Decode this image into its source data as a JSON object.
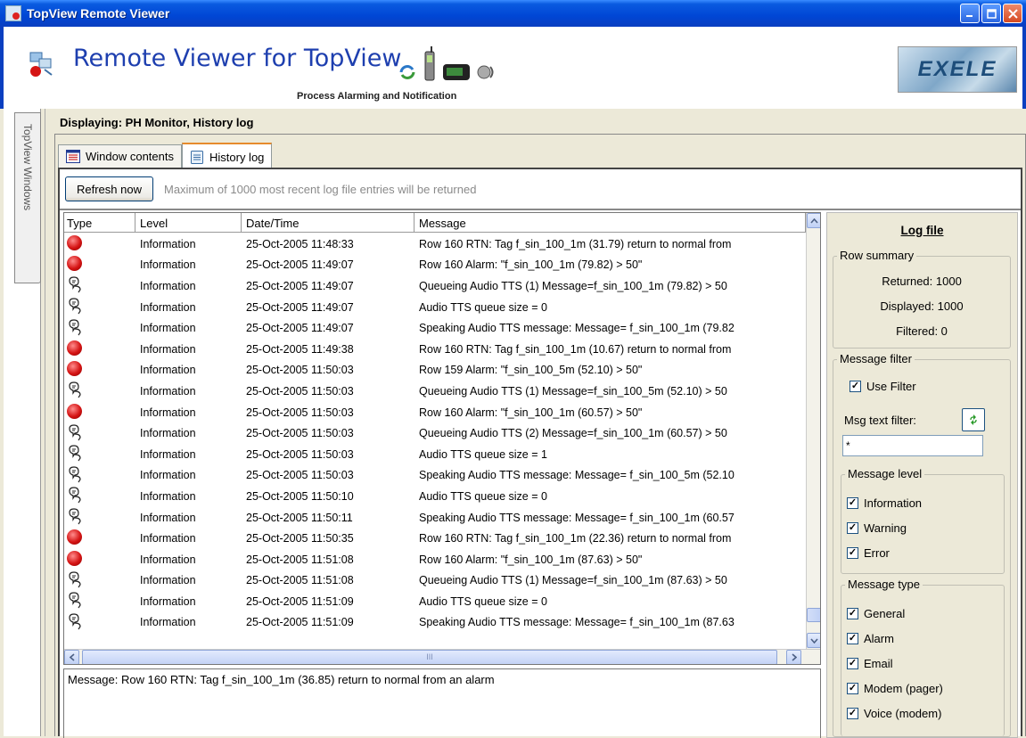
{
  "window": {
    "title": "TopView Remote Viewer"
  },
  "banner": {
    "headline": "Remote Viewer for TopView",
    "subtitle": "Process Alarming and Notification",
    "brand": "EXELE"
  },
  "rail": {
    "tab_label": "TopView Windows"
  },
  "main": {
    "displaying": "Displaying: PH Monitor, History log",
    "tabs": [
      {
        "label": "Window contents",
        "icon": "list-window-icon",
        "active": false
      },
      {
        "label": "History log",
        "icon": "document-icon",
        "active": true
      }
    ],
    "toolbar": {
      "refresh_label": "Refresh now",
      "hint": "Maximum of 1000 most recent log file entries will be returned"
    }
  },
  "table": {
    "columns": [
      "Type",
      "Level",
      "Date/Time",
      "Message"
    ],
    "rows": [
      {
        "type": "alarm",
        "level": "Information",
        "datetime": "25-Oct-2005 11:48:33",
        "message": "Row 160 RTN: Tag f_sin_100_1m (31.79) return to normal from"
      },
      {
        "type": "alarm",
        "level": "Information",
        "datetime": "25-Oct-2005 11:49:07",
        "message": "Row 160 Alarm: \"f_sin_100_1m (79.82) > 50\""
      },
      {
        "type": "voice",
        "level": "Information",
        "datetime": "25-Oct-2005 11:49:07",
        "message": "Queueing Audio TTS (1) Message=f_sin_100_1m (79.82) > 50"
      },
      {
        "type": "voice",
        "level": "Information",
        "datetime": "25-Oct-2005 11:49:07",
        "message": "Audio TTS queue size = 0"
      },
      {
        "type": "voice",
        "level": "Information",
        "datetime": "25-Oct-2005 11:49:07",
        "message": "Speaking Audio TTS message: Message= f_sin_100_1m (79.82"
      },
      {
        "type": "alarm",
        "level": "Information",
        "datetime": "25-Oct-2005 11:49:38",
        "message": "Row 160 RTN: Tag f_sin_100_1m (10.67) return to normal from"
      },
      {
        "type": "alarm",
        "level": "Information",
        "datetime": "25-Oct-2005 11:50:03",
        "message": "Row 159 Alarm: \"f_sin_100_5m (52.10) > 50\""
      },
      {
        "type": "voice",
        "level": "Information",
        "datetime": "25-Oct-2005 11:50:03",
        "message": "Queueing Audio TTS (1) Message=f_sin_100_5m (52.10) > 50"
      },
      {
        "type": "alarm",
        "level": "Information",
        "datetime": "25-Oct-2005 11:50:03",
        "message": "Row 160 Alarm: \"f_sin_100_1m (60.57) > 50\""
      },
      {
        "type": "voice",
        "level": "Information",
        "datetime": "25-Oct-2005 11:50:03",
        "message": "Queueing Audio TTS (2) Message=f_sin_100_1m (60.57) > 50"
      },
      {
        "type": "voice",
        "level": "Information",
        "datetime": "25-Oct-2005 11:50:03",
        "message": "Audio TTS queue size = 1"
      },
      {
        "type": "voice",
        "level": "Information",
        "datetime": "25-Oct-2005 11:50:03",
        "message": "Speaking Audio TTS message: Message= f_sin_100_5m (52.10"
      },
      {
        "type": "voice",
        "level": "Information",
        "datetime": "25-Oct-2005 11:50:10",
        "message": "Audio TTS queue size = 0"
      },
      {
        "type": "voice",
        "level": "Information",
        "datetime": "25-Oct-2005 11:50:11",
        "message": "Speaking Audio TTS message: Message= f_sin_100_1m (60.57"
      },
      {
        "type": "alarm",
        "level": "Information",
        "datetime": "25-Oct-2005 11:50:35",
        "message": "Row 160 RTN: Tag f_sin_100_1m (22.36) return to normal from"
      },
      {
        "type": "alarm",
        "level": "Information",
        "datetime": "25-Oct-2005 11:51:08",
        "message": "Row 160 Alarm: \"f_sin_100_1m (87.63) > 50\""
      },
      {
        "type": "voice",
        "level": "Information",
        "datetime": "25-Oct-2005 11:51:08",
        "message": "Queueing Audio TTS (1) Message=f_sin_100_1m (87.63) > 50"
      },
      {
        "type": "voice",
        "level": "Information",
        "datetime": "25-Oct-2005 11:51:09",
        "message": "Audio TTS queue size = 0"
      },
      {
        "type": "voice",
        "level": "Information",
        "datetime": "25-Oct-2005 11:51:09",
        "message": "Speaking Audio TTS message: Message= f_sin_100_1m (87.63"
      }
    ],
    "hscroll_grip": "III"
  },
  "detail": {
    "text": "Message: Row 160 RTN: Tag f_sin_100_1m (36.85) return to normal from an alarm"
  },
  "sidepanel": {
    "title": "Log file",
    "row_summary": {
      "legend": "Row summary",
      "returned": "Returned: 1000",
      "displayed": "Displayed: 1000",
      "filtered": "Filtered: 0"
    },
    "message_filter": {
      "legend": "Message filter",
      "use_filter_label": "Use Filter",
      "use_filter_checked": true,
      "text_filter_label": "Msg text filter:",
      "text_filter_value": "*"
    },
    "message_level": {
      "legend": "Message level",
      "items": [
        {
          "label": "Information",
          "checked": true
        },
        {
          "label": "Warning",
          "checked": true
        },
        {
          "label": "Error",
          "checked": true
        }
      ]
    },
    "message_type": {
      "legend": "Message type",
      "items": [
        {
          "label": "General",
          "checked": true
        },
        {
          "label": "Alarm",
          "checked": true
        },
        {
          "label": "Email",
          "checked": true
        },
        {
          "label": "Modem (pager)",
          "checked": true
        },
        {
          "label": "Voice (modem)",
          "checked": true
        }
      ]
    }
  },
  "colors": {
    "titlebar": "#0046D5",
    "headline": "#1E3FAF",
    "alarm": "#D51414",
    "active_tab_accent": "#E68B2C"
  }
}
